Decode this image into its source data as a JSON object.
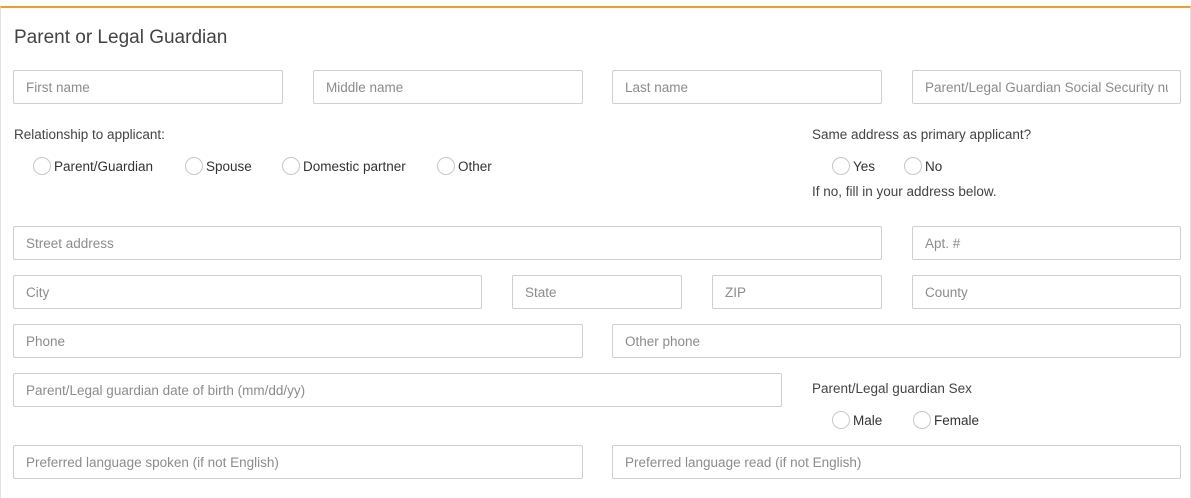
{
  "section": {
    "title": "Parent or Legal Guardian"
  },
  "name": {
    "first_placeholder": "First name",
    "middle_placeholder": "Middle name",
    "last_placeholder": "Last name",
    "ssn_placeholder": "Parent/Legal Guardian Social Security number"
  },
  "relationship": {
    "label": "Relationship to applicant:",
    "options": [
      "Parent/Guardian",
      "Spouse",
      "Domestic partner",
      "Other"
    ]
  },
  "same_address": {
    "label": "Same address as primary applicant?",
    "options": [
      "Yes",
      "No"
    ],
    "hint": "If no, fill in your address below."
  },
  "address": {
    "street_placeholder": "Street address",
    "apt_placeholder": "Apt. #",
    "city_placeholder": "City",
    "state_placeholder": "State",
    "zip_placeholder": "ZIP",
    "county_placeholder": "County"
  },
  "contact": {
    "phone_placeholder": "Phone",
    "other_phone_placeholder": "Other phone"
  },
  "dob": {
    "placeholder": "Parent/Legal guardian date of birth (mm/dd/yy)"
  },
  "sex": {
    "label": "Parent/Legal guardian Sex",
    "options": [
      "Male",
      "Female"
    ]
  },
  "language": {
    "spoken_placeholder": "Preferred language spoken (if not English)",
    "read_placeholder": "Preferred language read (if not English)"
  },
  "colors": {
    "accent": "#f29a2e",
    "border": "#cfcfcf",
    "placeholder": "#8c8c8c"
  }
}
